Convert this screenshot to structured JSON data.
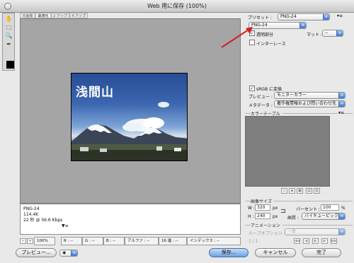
{
  "window": {
    "title": "Web 用に保存 (100%)"
  },
  "tabs": [
    "元画像",
    "最適化",
    "2 アップ",
    "4 アップ"
  ],
  "tools": [
    "✋",
    "⬚",
    "🔍",
    "✒"
  ],
  "image": {
    "overlay_text": "浅間山"
  },
  "info_panel": {
    "lines": [
      "PNG-24",
      "114.4K",
      "22 秒 @ 56.6 Kbps"
    ],
    "menu": "▼≡"
  },
  "status": {
    "zoom": "100%",
    "r": "R : --",
    "g": "G : --",
    "b": "B : --",
    "alpha": "アルファ : --",
    "hex": "16 進 : --",
    "index": "インデックス : --"
  },
  "buttons": {
    "preview": "プレビュー...",
    "save": "保存...",
    "cancel": "キャンセル",
    "done": "完了"
  },
  "settings": {
    "preset_label": "プリセット :",
    "preset_value": "PNG-24",
    "format_value": "PNG-24",
    "transparency": "透明部分",
    "matte_label": "マット :",
    "matte_value": "--",
    "interlace": "インターレース",
    "srgb": "sRGB に変換",
    "preview_label": "プレビュー :",
    "preview_value": "モニターカラー",
    "metadata_label": "メタデータ :",
    "metadata_value": "著作権情報および問い合わせ先",
    "color_table_title": "カラーテーブル",
    "image_size_title": "画像サイズ",
    "w_label": "W :",
    "w_value": "320",
    "h_label": "H :",
    "h_value": "240",
    "px": "px",
    "percent_label": "パーセント :",
    "percent_value": "100",
    "percent_unit": "%",
    "quality_label": "画質 :",
    "quality_value": "バイキュービック法",
    "animation_title": "アニメーション",
    "loop_label": "ループオプション :",
    "loop_value": "一度",
    "frame_value": "1 / 1"
  }
}
